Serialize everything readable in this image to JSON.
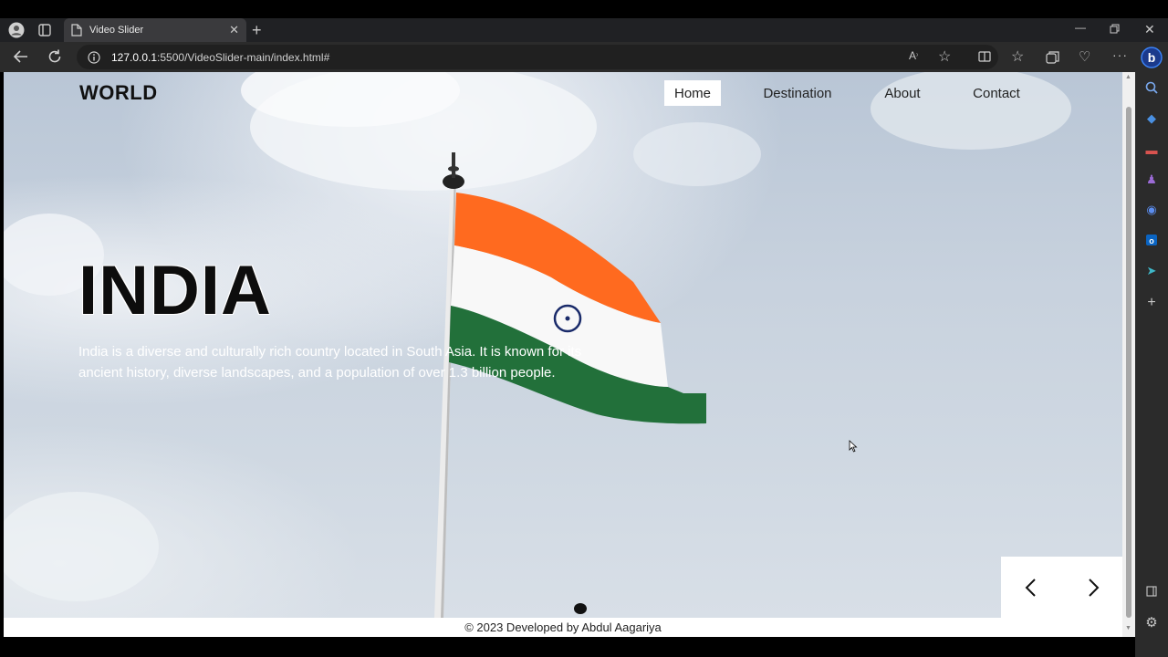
{
  "browser": {
    "tab_title": "Video Slider",
    "url_host": "127.0.0.1",
    "url_rest": ":5500/VideoSlider-main/index.html#"
  },
  "page": {
    "logo": "WORLD",
    "nav": [
      {
        "label": "Home",
        "active": true
      },
      {
        "label": "Destination",
        "active": false
      },
      {
        "label": "About",
        "active": false
      },
      {
        "label": "Contact",
        "active": false
      }
    ],
    "hero": {
      "title": "INDIA",
      "description": "India is a diverse and culturally rich country located in South Asia. It is known for its ancient history, diverse landscapes, and a population of over 1.3 billion people."
    },
    "footer": "© 2023 Developed by Abdul Aagariya",
    "colors": {
      "flag_saffron": "#ff6a1f",
      "flag_white": "#ffffff",
      "flag_green": "#1f6b32",
      "chakra_blue": "#1a2b6a"
    }
  }
}
